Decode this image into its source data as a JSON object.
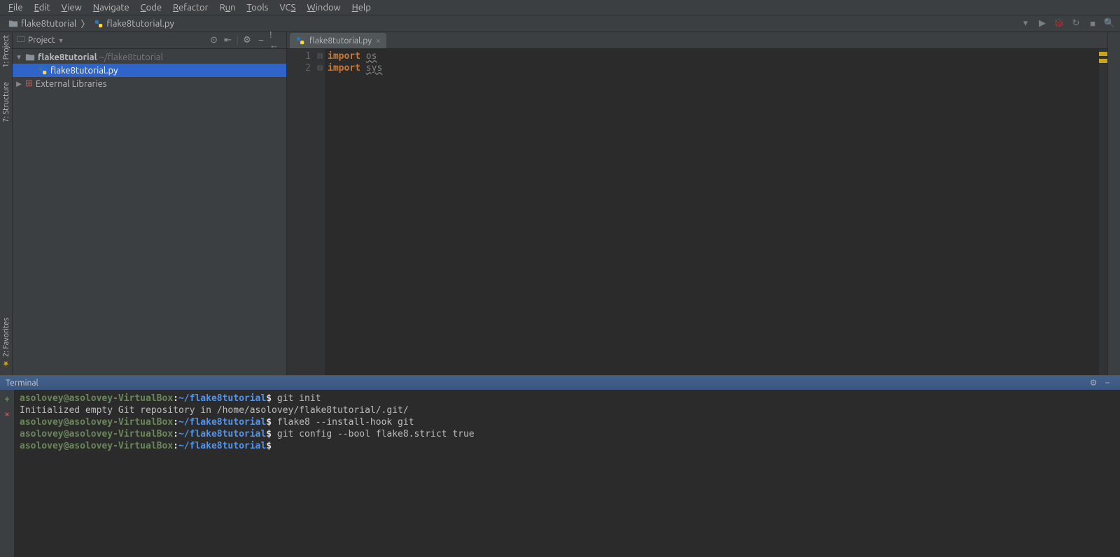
{
  "menu": [
    "File",
    "Edit",
    "View",
    "Navigate",
    "Code",
    "Refactor",
    "Run",
    "Tools",
    "VCS",
    "Window",
    "Help"
  ],
  "breadcrumb": {
    "project": "flake8tutorial",
    "file": "flake8tutorial.py"
  },
  "project_panel": {
    "title": "Project",
    "root": {
      "name": "flake8tutorial",
      "path": "~/flake8tutorial"
    },
    "file": "flake8tutorial.py",
    "ext": "External Libraries"
  },
  "left_tabs": {
    "project": "1: Project",
    "structure": "7: Structure",
    "favorites": "2: Favorites"
  },
  "editor": {
    "tab": "flake8tutorial.py",
    "lines": [
      {
        "n": "1",
        "kw": "import",
        "id": "os"
      },
      {
        "n": "2",
        "kw": "import",
        "id": "sys"
      }
    ]
  },
  "terminal": {
    "title": "Terminal",
    "prompt": {
      "user": "asolovey",
      "host": "asolovey-VirtualBox",
      "path": "~/flake8tutorial",
      "sep1": "@",
      "sep2": ":",
      "dollar": "$"
    },
    "lines": [
      {
        "type": "prompt",
        "cmd": "git init"
      },
      {
        "type": "out",
        "text": "Initialized empty Git repository in /home/asolovey/flake8tutorial/.git/"
      },
      {
        "type": "prompt",
        "cmd": "flake8 --install-hook git"
      },
      {
        "type": "prompt",
        "cmd": "git config --bool flake8.strict true"
      },
      {
        "type": "prompt",
        "cmd": ""
      }
    ]
  }
}
